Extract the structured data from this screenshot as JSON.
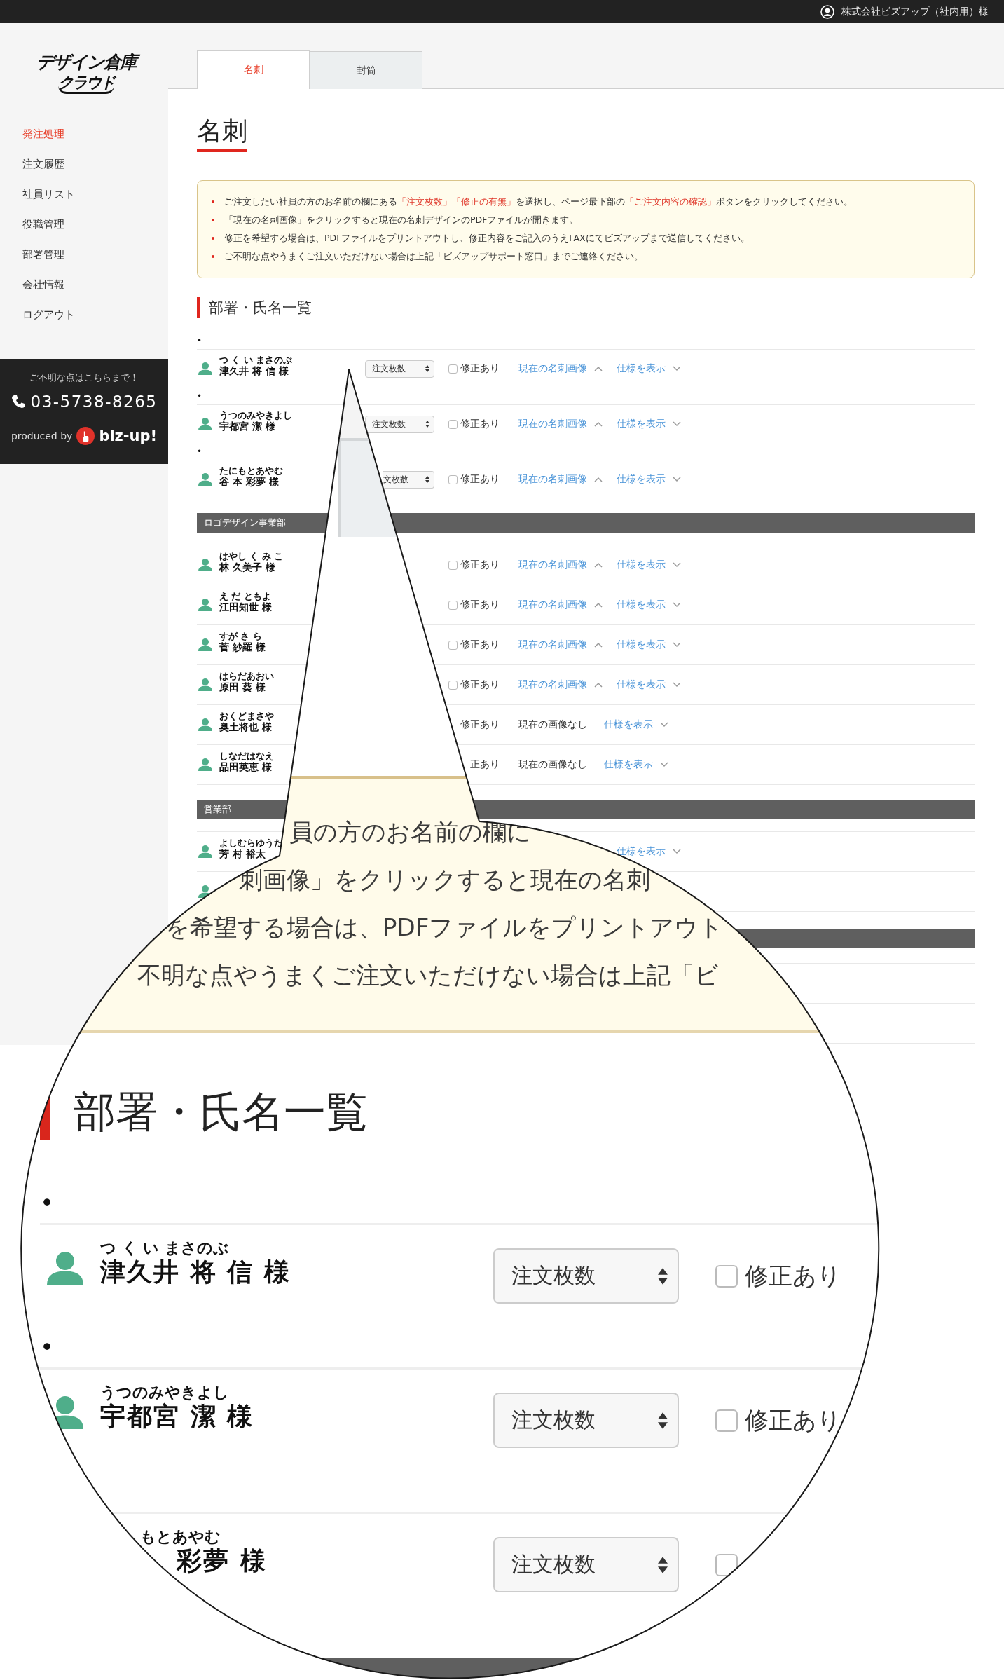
{
  "top_bar": {
    "account": "株式会社ビズアップ（社内用）様"
  },
  "sidebar": {
    "logo_lines": [
      "デザイン倉庫",
      "クラウド"
    ],
    "items": [
      {
        "label": "発注処理",
        "selected": true
      },
      {
        "label": "注文履歴",
        "selected": false
      },
      {
        "label": "社員リスト",
        "selected": false
      },
      {
        "label": "役職管理",
        "selected": false
      },
      {
        "label": "部署管理",
        "selected": false
      },
      {
        "label": "会社情報",
        "selected": false
      },
      {
        "label": "ログアウト",
        "selected": false
      }
    ],
    "contact": {
      "prompt": "ご不明な点はこちらまで！",
      "phone": "03-5738-8265",
      "produced_by": "produced by",
      "brand": "biz-up!"
    }
  },
  "tabs": [
    {
      "label": "名刺",
      "selected": true
    },
    {
      "label": "封筒",
      "selected": false
    }
  ],
  "page_title": "名刺",
  "notice": [
    {
      "segments": [
        {
          "text": "ご注文したい社員の方のお名前の欄にある",
          "highlight": false
        },
        {
          "text": "「注文枚数」「修正の有無」",
          "highlight": true
        },
        {
          "text": "を選択し、ページ最下部の",
          "highlight": false
        },
        {
          "text": "「ご注文内容の確認」",
          "highlight": true
        },
        {
          "text": "ボタンをクリックしてください。",
          "highlight": false
        }
      ]
    },
    {
      "segments": [
        {
          "text": "「現在の名刺画像」をクリックすると現在の名刺デザインのPDFファイルが開きます。",
          "highlight": false
        }
      ]
    },
    {
      "segments": [
        {
          "text": "修正を希望する場合は、PDFファイルをプリントアウトし、修正内容をご記入のうえFAXにてビズアップまで送信してください。",
          "highlight": false
        }
      ]
    },
    {
      "segments": [
        {
          "text": "ご不明な点やうまくご注文いただけない場合は上記「ビズアップサポート窓口」までご連絡ください。",
          "highlight": false
        }
      ]
    }
  ],
  "section_title": "部署・氏名一覧",
  "groups": [
    {
      "rows": [
        {
          "bullet": "•",
          "ruby": "つ く い まさのぶ",
          "name": "津久井 将 信 様",
          "select": "注文枚数",
          "checked": false,
          "check_label": "修正あり",
          "image_link": "現在の名刺画像",
          "spec": "仕様を表示"
        },
        {
          "bullet": "•",
          "ruby": "うつのみやきよし",
          "name": "宇都宮 潔 様",
          "select": "注文枚数",
          "checked": false,
          "check_label": "修正あり",
          "image_link": "現在の名刺画像",
          "spec": "仕様を表示"
        },
        {
          "bullet": "•",
          "ruby": "たにもとあやむ",
          "name": "谷 本 彩夢 様",
          "select": "文枚数",
          "checked": false,
          "check_label": "修正あり",
          "image_link": "現在の名刺画像",
          "spec": "仕様を表示"
        }
      ]
    },
    {
      "title": "ロゴデザイン事業部",
      "rows": [
        {
          "ruby": "はやし く み こ",
          "name": "林 久美子 様",
          "checked": false,
          "check_label": "修正あり",
          "image_link": "現在の名刺画像",
          "spec": "仕様を表示"
        },
        {
          "ruby": "え だ ともよ",
          "name": "江田知世 様",
          "checked": false,
          "check_label": "修正あり",
          "image_link": "現在の名刺画像",
          "spec": "仕様を表示"
        },
        {
          "ruby": "すが さ ら",
          "name": "菅 紗羅 様",
          "checked": false,
          "check_label": "修正あり",
          "image_link": "現在の名刺画像",
          "spec": "仕様を表示"
        },
        {
          "ruby": "はらだあおい",
          "name": "原田 葵 様",
          "checked": false,
          "check_label": "修正あり",
          "image_link": "現在の名刺画像",
          "spec": "仕様を表示"
        },
        {
          "ruby": "おくどまさや",
          "name": "奥土将也 様",
          "check_label": "修正あり",
          "no_image": "現在の画像なし",
          "spec": "仕様を表示"
        },
        {
          "ruby": "しなだはなえ",
          "name": "品田英恵 様",
          "check_label": "正あり",
          "no_image": "現在の画像なし",
          "spec": "仕様を表示"
        }
      ]
    },
    {
      "title": "営業部",
      "rows": [
        {
          "ruby": "よしむらゆうた",
          "name": "芳 村 裕太",
          "spec": "仕様を表示"
        },
        {}
      ]
    }
  ],
  "magnifier": {
    "notice_lines": [
      "員の方のお名前の欄に",
      "刺画像」をクリックすると現在の名刺",
      "を希望する場合は、PDFファイルをプリントアウト",
      "不明な点やうまくご注文いただけない場合は上記「ビ"
    ],
    "section_title": "部署・氏名一覧",
    "rows": [
      {
        "bullet": "•",
        "ruby": "つ く い まさのぶ",
        "name": "津久井 将 信 様",
        "select": "注文枚数",
        "checked": false,
        "check_label": "修正あり"
      },
      {
        "bullet": "•",
        "ruby": "うつのみやきよし",
        "name": "宇都宮 潔 様",
        "select": "注文枚数",
        "checked": false,
        "check_label": "修正あり"
      },
      {
        "ruby": "もとあやむ",
        "name": "彩夢 様",
        "select": "注文枚数",
        "checked": false
      }
    ]
  }
}
